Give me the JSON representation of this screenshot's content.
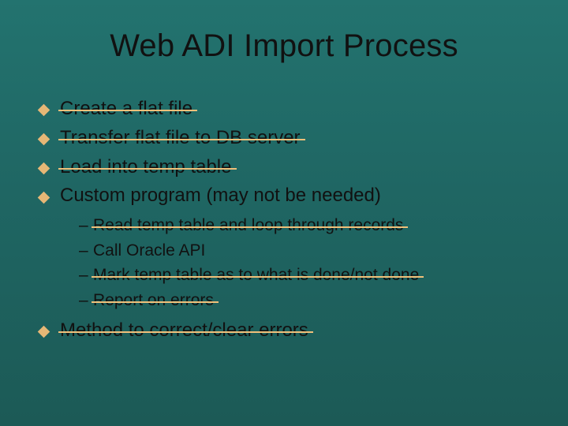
{
  "title": "Web ADI Import Process",
  "bullets": [
    {
      "text": "Create a flat file",
      "strike": true
    },
    {
      "text": "Transfer flat file to DB server",
      "strike": true
    },
    {
      "text": "Load into temp table",
      "strike": true
    },
    {
      "text": "Custom program (may not be needed)",
      "strike": false,
      "sub": [
        {
          "text": "Read temp table and loop through records",
          "strike": true
        },
        {
          "text": "Call Oracle API",
          "strike": false
        },
        {
          "text": "Mark temp table as to what is done/not done",
          "strike": true
        },
        {
          "text": "Report on errors",
          "strike": true
        }
      ]
    },
    {
      "text": "Method to correct/clear errors",
      "strike": true
    }
  ],
  "colors": {
    "accent": "#e6b776",
    "background": "#1f6663",
    "text": "#111111"
  }
}
